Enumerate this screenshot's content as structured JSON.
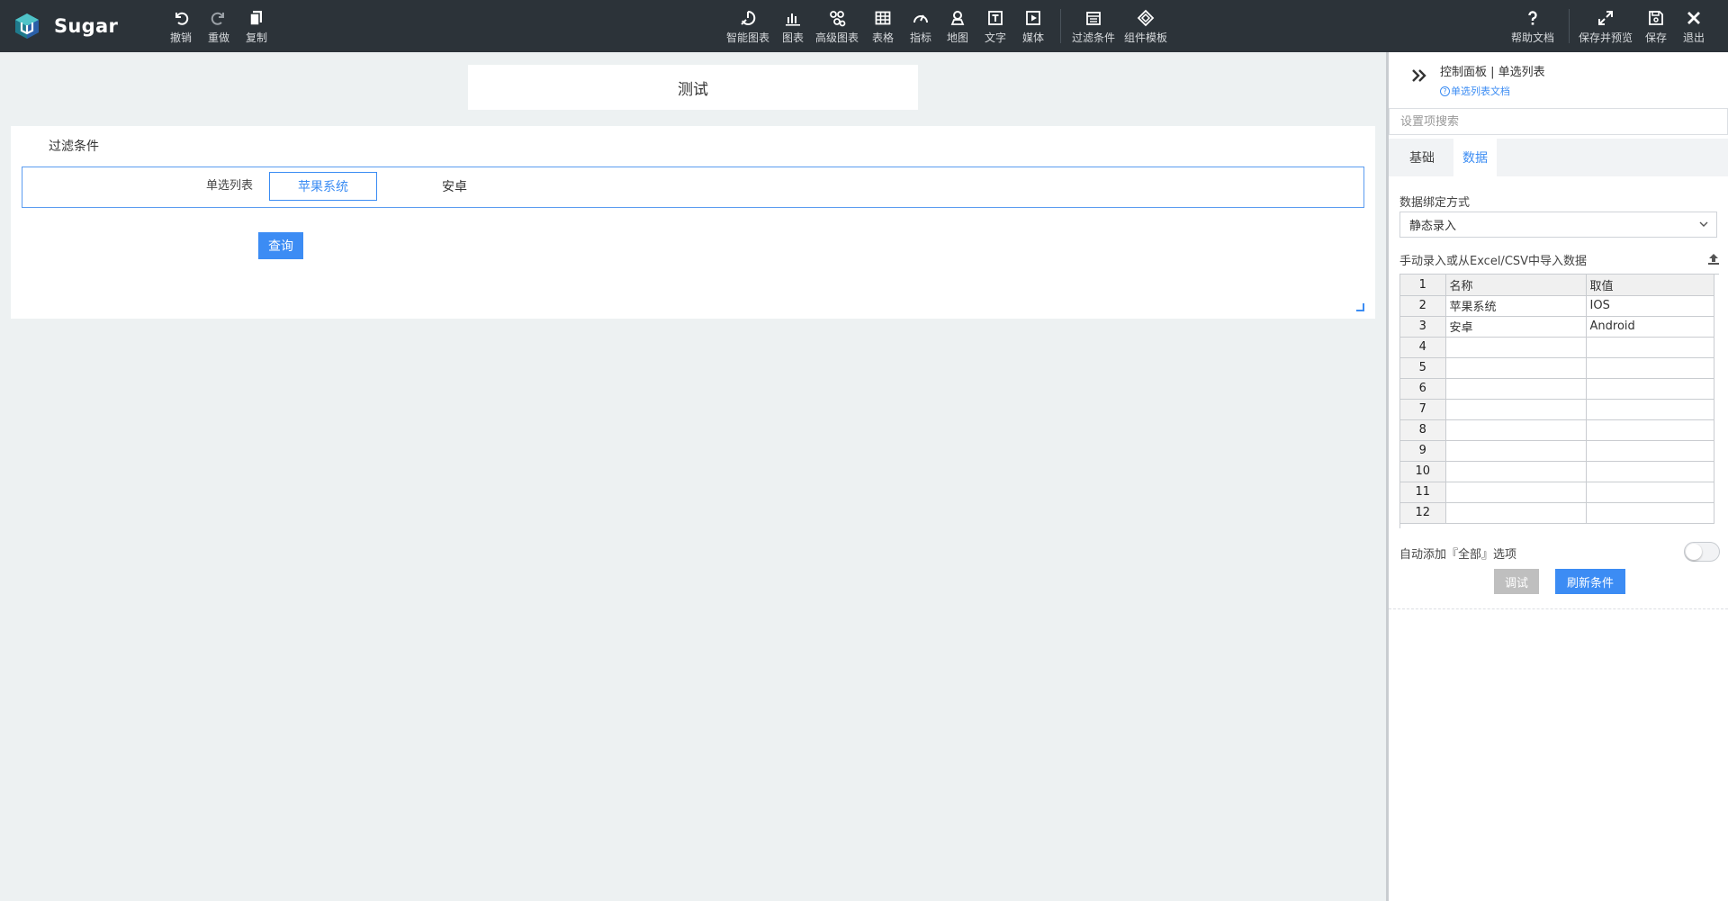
{
  "app": {
    "name": "Sugar"
  },
  "colors": {
    "topbar": "#2c3339",
    "accent": "#3b8cf3",
    "canvas": "#edf1f2"
  },
  "toolbar": {
    "left": [
      {
        "label": "撤销",
        "icon": "undo-icon"
      },
      {
        "label": "重做",
        "icon": "redo-icon"
      },
      {
        "label": "复制",
        "icon": "copy-icon"
      }
    ],
    "center": [
      {
        "label": "智能图表",
        "icon": "smart-chart-icon"
      },
      {
        "label": "图表",
        "icon": "bar-chart-icon"
      },
      {
        "label": "高级图表",
        "icon": "advanced-chart-icon"
      },
      {
        "label": "表格",
        "icon": "table-icon"
      },
      {
        "label": "指标",
        "icon": "gauge-icon"
      },
      {
        "label": "地图",
        "icon": "map-pin-icon"
      },
      {
        "label": "文字",
        "icon": "text-icon"
      },
      {
        "label": "媒体",
        "icon": "media-icon"
      },
      {
        "label": "过滤条件",
        "icon": "filter-calendar-icon"
      },
      {
        "label": "组件模板",
        "icon": "template-icon"
      }
    ],
    "right": [
      {
        "label": "帮助文档",
        "icon": "help-icon"
      },
      {
        "label": "保存并预览",
        "icon": "expand-icon"
      },
      {
        "label": "保存",
        "icon": "save-icon"
      },
      {
        "label": "退出",
        "icon": "close-icon"
      }
    ]
  },
  "canvas": {
    "title": "测试",
    "filter": {
      "title": "过滤条件",
      "label": "单选列表",
      "options": [
        "苹果系统",
        "安卓"
      ],
      "selected": "苹果系统",
      "query_label": "查询"
    }
  },
  "panel": {
    "title": "控制面板 | 单选列表",
    "doc_link": "单选列表文档",
    "search_placeholder": "设置项搜索",
    "tabs": [
      "基础",
      "数据"
    ],
    "active_tab": "数据",
    "binding_label": "数据绑定方式",
    "binding_value": "静态录入",
    "import_label": "手动录入或从Excel/CSV中导入数据",
    "sheet": {
      "rows": [
        [
          "1",
          "名称",
          "取值"
        ],
        [
          "2",
          "苹果系统",
          "IOS"
        ],
        [
          "3",
          "安卓",
          "Android"
        ],
        [
          "4",
          "",
          ""
        ],
        [
          "5",
          "",
          ""
        ],
        [
          "6",
          "",
          ""
        ],
        [
          "7",
          "",
          ""
        ],
        [
          "8",
          "",
          ""
        ],
        [
          "9",
          "",
          ""
        ],
        [
          "10",
          "",
          ""
        ],
        [
          "11",
          "",
          ""
        ],
        [
          "12",
          "",
          ""
        ]
      ]
    },
    "auto_all_label": "自动添加『全部』选项",
    "auto_all_enabled": false,
    "debug_label": "调试",
    "refresh_label": "刷新条件"
  }
}
